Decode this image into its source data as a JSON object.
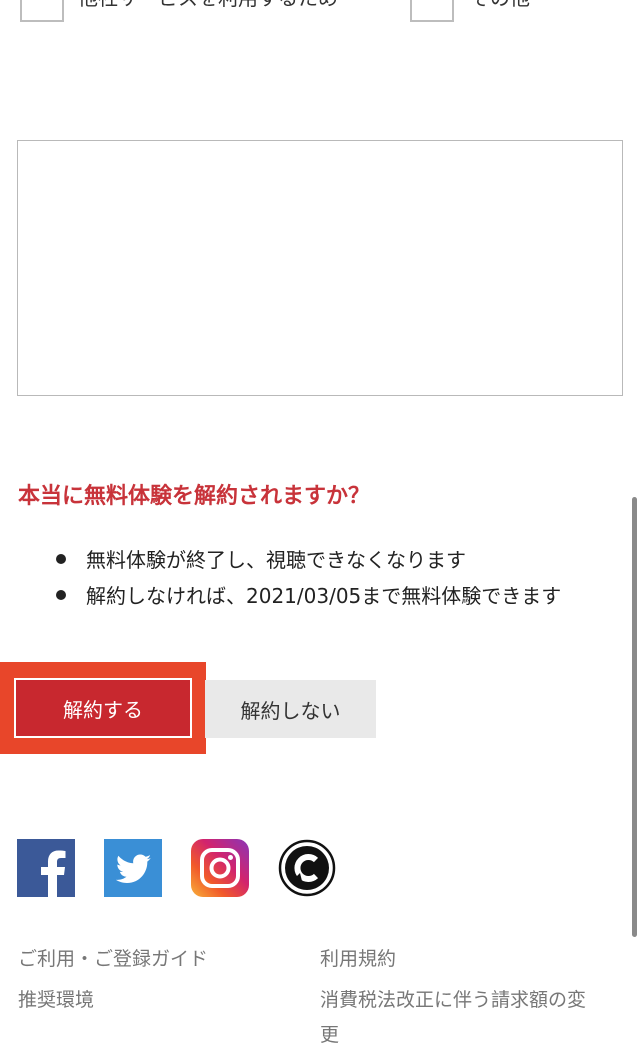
{
  "reasons": {
    "option_other_service": "他社サービスを利用するため",
    "option_other": "その他"
  },
  "comment": {
    "value": "",
    "placeholder": ""
  },
  "confirm": {
    "title": "本当に無料体験を解約されますか？",
    "notes": [
      "無料体験が終了し、視聴できなくなります",
      "解約しなければ、2021/03/05まで無料体験できます"
    ]
  },
  "buttons": {
    "cancel": "解約する",
    "keep": "解約しない"
  },
  "social": {
    "icons": [
      "facebook-icon",
      "twitter-icon",
      "instagram-icon",
      "circle-logo-icon"
    ]
  },
  "footer": {
    "guide": "ご利用・ご登録ガイド",
    "terms": "利用規約",
    "environment": "推奨環境",
    "tax_change_line1": "消費税法改正に伴う請求額の変",
    "tax_change_line2": "更"
  },
  "colors": {
    "accent_red": "#c8282f",
    "highlight_orange": "#e8462a",
    "title_red": "#c8333a"
  }
}
